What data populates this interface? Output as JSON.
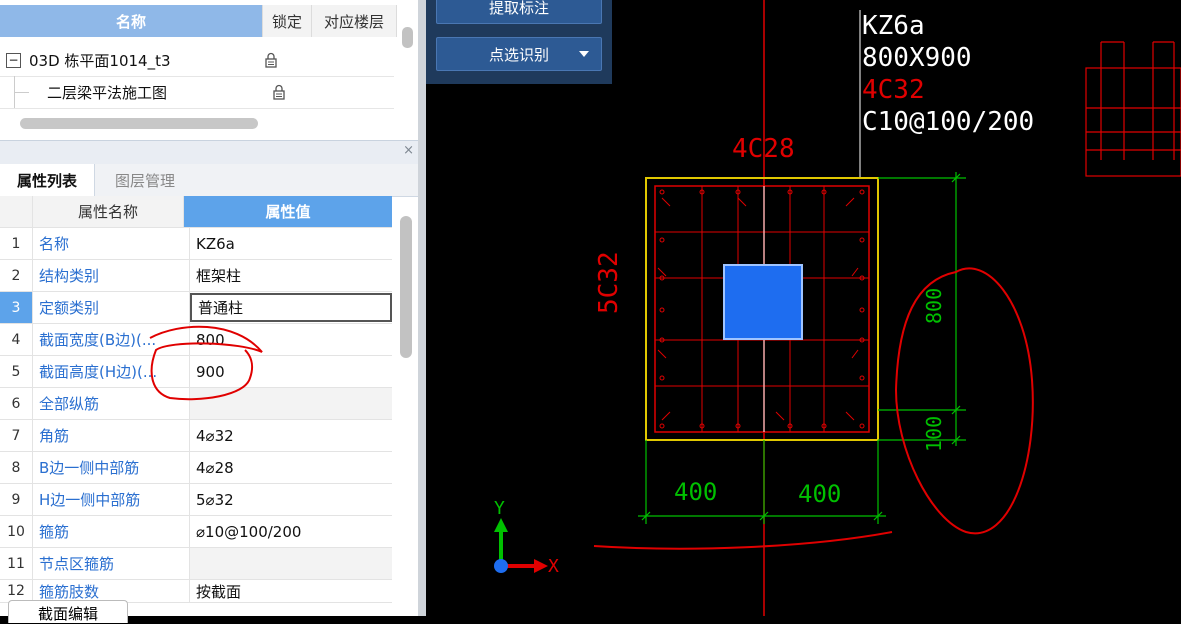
{
  "layers": {
    "headers": {
      "name": "名称",
      "lock": "锁定",
      "floor": "对应楼层"
    },
    "rows": [
      {
        "toggle": "−",
        "name": "03D 栋平面1014_t3"
      },
      {
        "name": "二层梁平法施工图"
      }
    ]
  },
  "panel_tabs": {
    "properties": "属性列表",
    "layers": "图层管理",
    "close": "×"
  },
  "props": {
    "col_name": "属性名称",
    "col_value": "属性值",
    "rows": [
      {
        "n": "1",
        "name": "名称",
        "value": "KZ6a"
      },
      {
        "n": "2",
        "name": "结构类别",
        "value": "框架柱"
      },
      {
        "n": "3",
        "name": "定额类别",
        "value": "普通柱"
      },
      {
        "n": "4",
        "name": "截面宽度(B边)(...",
        "value": "800"
      },
      {
        "n": "5",
        "name": "截面高度(H边)(...",
        "value": "900"
      },
      {
        "n": "6",
        "name": "全部纵筋",
        "value": ""
      },
      {
        "n": "7",
        "name": "角筋",
        "value": "4⌀32"
      },
      {
        "n": "8",
        "name": "B边一侧中部筋",
        "value": "4⌀28"
      },
      {
        "n": "9",
        "name": "H边一侧中部筋",
        "value": "5⌀32"
      },
      {
        "n": "10",
        "name": "箍筋",
        "value": "⌀10@100/200"
      },
      {
        "n": "11",
        "name": "节点区箍筋",
        "value": ""
      },
      {
        "n": "12",
        "name": "箍筋肢数",
        "value": "按截面"
      }
    ]
  },
  "bottom_button": "截面编辑",
  "toolbar": {
    "extract": "提取标注",
    "pick": "点选识别",
    "dropdown_icon": "triangle-down"
  },
  "cad": {
    "annotation_lines": [
      "KZ6a",
      "800X900",
      "4C32",
      "C10@100/200"
    ],
    "top_rebar": "4C28",
    "side_rebar": "5C32",
    "dim_800": "800",
    "dim_100": "100",
    "dim_400a": "400",
    "dim_400b": "400",
    "axis_y": "Y",
    "axis_x": "X",
    "colors": {
      "yellow": "#e0c800",
      "red": "#e00000",
      "green": "#00c000",
      "blue": "#1e6df0",
      "white": "#ffffff"
    }
  }
}
